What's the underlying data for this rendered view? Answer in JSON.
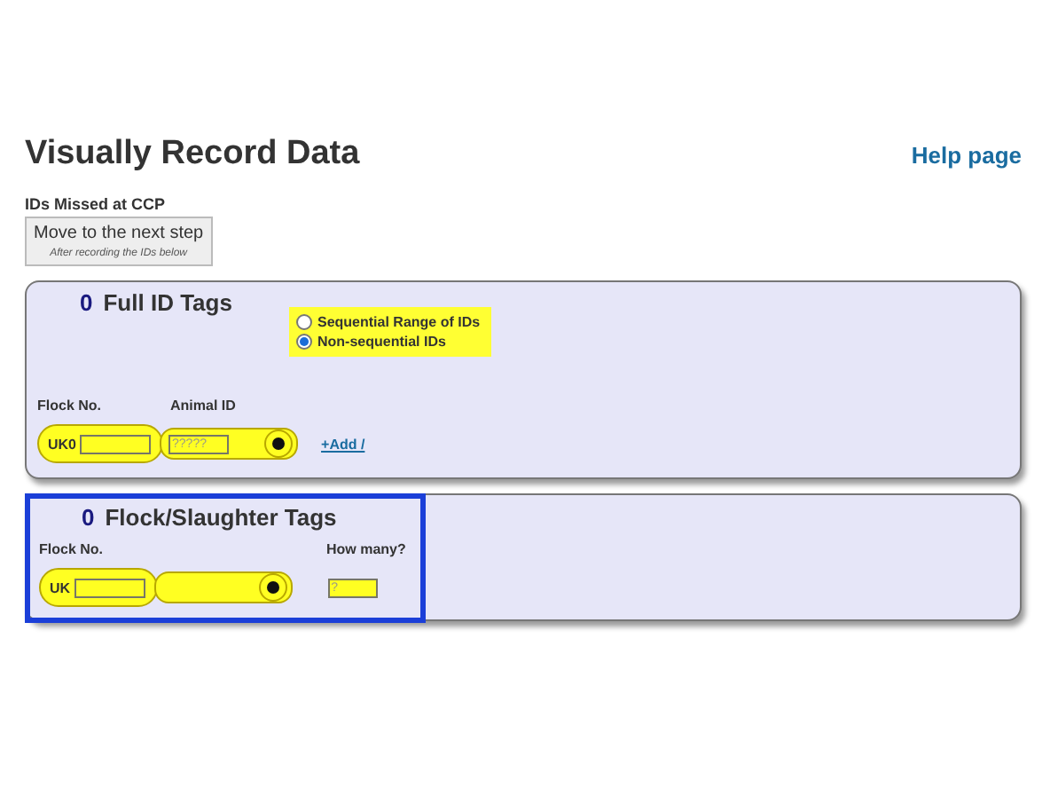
{
  "page": {
    "title": "Visually Record Data",
    "help_link": "Help page"
  },
  "missed": {
    "label": "IDs Missed at CCP",
    "button": {
      "label": "Move to the next step",
      "hint": "After recording the IDs below"
    }
  },
  "full_id": {
    "count": "0",
    "title": "Full ID Tags",
    "modes": [
      {
        "label": "Sequential Range of IDs",
        "selected": false
      },
      {
        "label": "Non-sequential IDs",
        "selected": true
      }
    ],
    "flock_label": "Flock No.",
    "animal_label": "Animal ID",
    "prefix": "UK0",
    "animal_placeholder": "?????",
    "add_link": "+Add /"
  },
  "flock_tags": {
    "count": "0",
    "title": "Flock/Slaughter Tags",
    "flock_label": "Flock No.",
    "how_many_label": "How many?",
    "prefix": "UK",
    "how_many_placeholder": "?",
    "highlighted": true
  }
}
